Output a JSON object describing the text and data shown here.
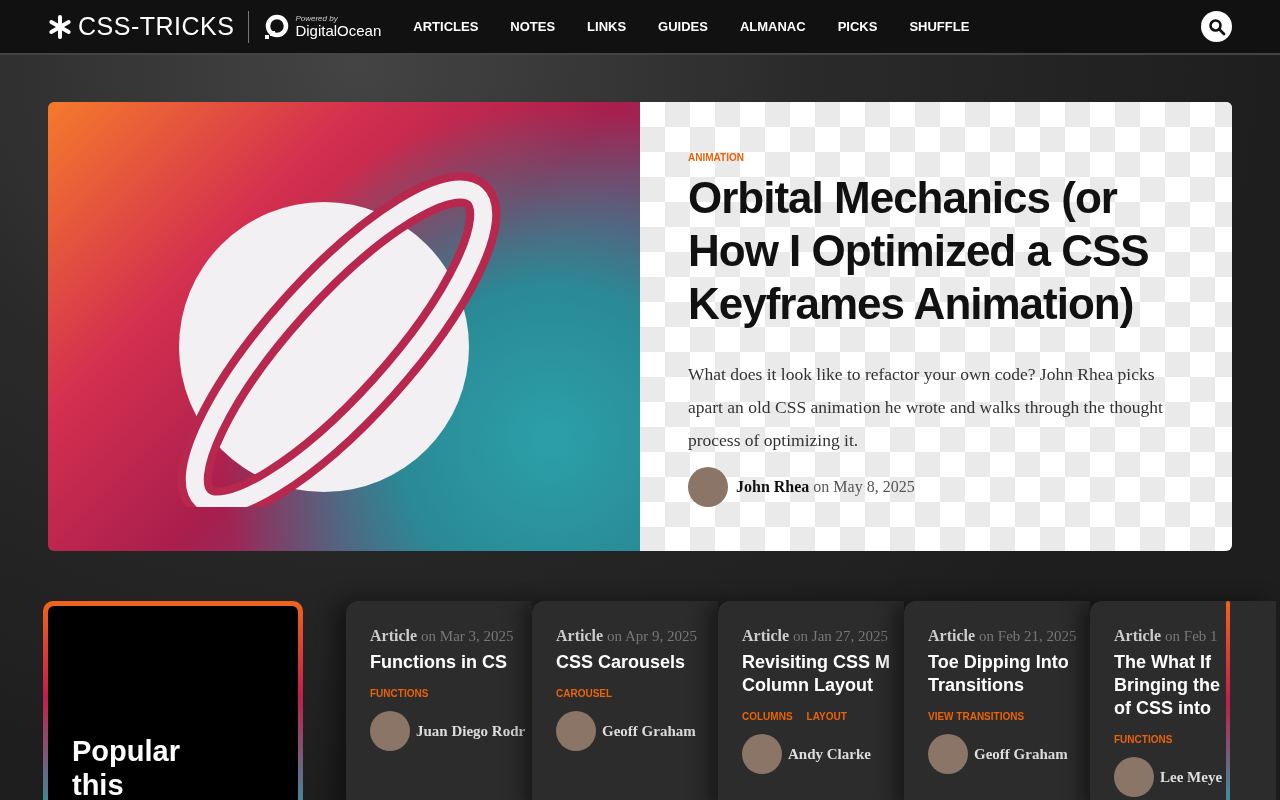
{
  "header": {
    "logo": "CSS-TRICKS",
    "sponsor_caption": "Powered by",
    "sponsor": "DigitalOcean",
    "nav": [
      "ARTICLES",
      "NOTES",
      "LINKS",
      "GUIDES",
      "ALMANAC",
      "PICKS",
      "SHUFFLE"
    ]
  },
  "hero": {
    "tag": "ANIMATION",
    "title": "Orbital Mechanics (or How I Optimized a CSS Keyframes Animation)",
    "excerpt": "What does it look like to refactor your own code? John Rhea picks apart an old CSS animation he wrote and walks through the thought process of optimizing it.",
    "author": "John Rhea",
    "date": "on May 8, 2025"
  },
  "popular": {
    "title": "Popular this"
  },
  "cards": [
    {
      "type": "Article",
      "date": "on Mar 3, 2025",
      "title_lines": [
        "Functions in CS"
      ],
      "tags": [
        "FUNCTIONS"
      ],
      "author": "Juan Diego Rodr"
    },
    {
      "type": "Article",
      "date": "on Apr 9, 2025",
      "title_lines": [
        "CSS Carousels"
      ],
      "tags": [
        "CAROUSEL"
      ],
      "author": "Geoff Graham"
    },
    {
      "type": "Article",
      "date": "on Jan 27, 2025",
      "title_lines": [
        "Revisiting CSS M",
        "Column Layout"
      ],
      "tags": [
        "COLUMNS",
        "LAYOUT"
      ],
      "author": "Andy Clarke"
    },
    {
      "type": "Article",
      "date": "on Feb 21, 2025",
      "title_lines": [
        "Toe Dipping Into",
        "Transitions"
      ],
      "tags": [
        "VIEW TRANSITIONS"
      ],
      "author": "Geoff Graham"
    },
    {
      "type": "Article",
      "date": "on Feb 1",
      "title_lines": [
        "The What If",
        "Bringing the",
        "of CSS into"
      ],
      "tags": [
        "FUNCTIONS"
      ],
      "author": "Lee Meye"
    }
  ]
}
